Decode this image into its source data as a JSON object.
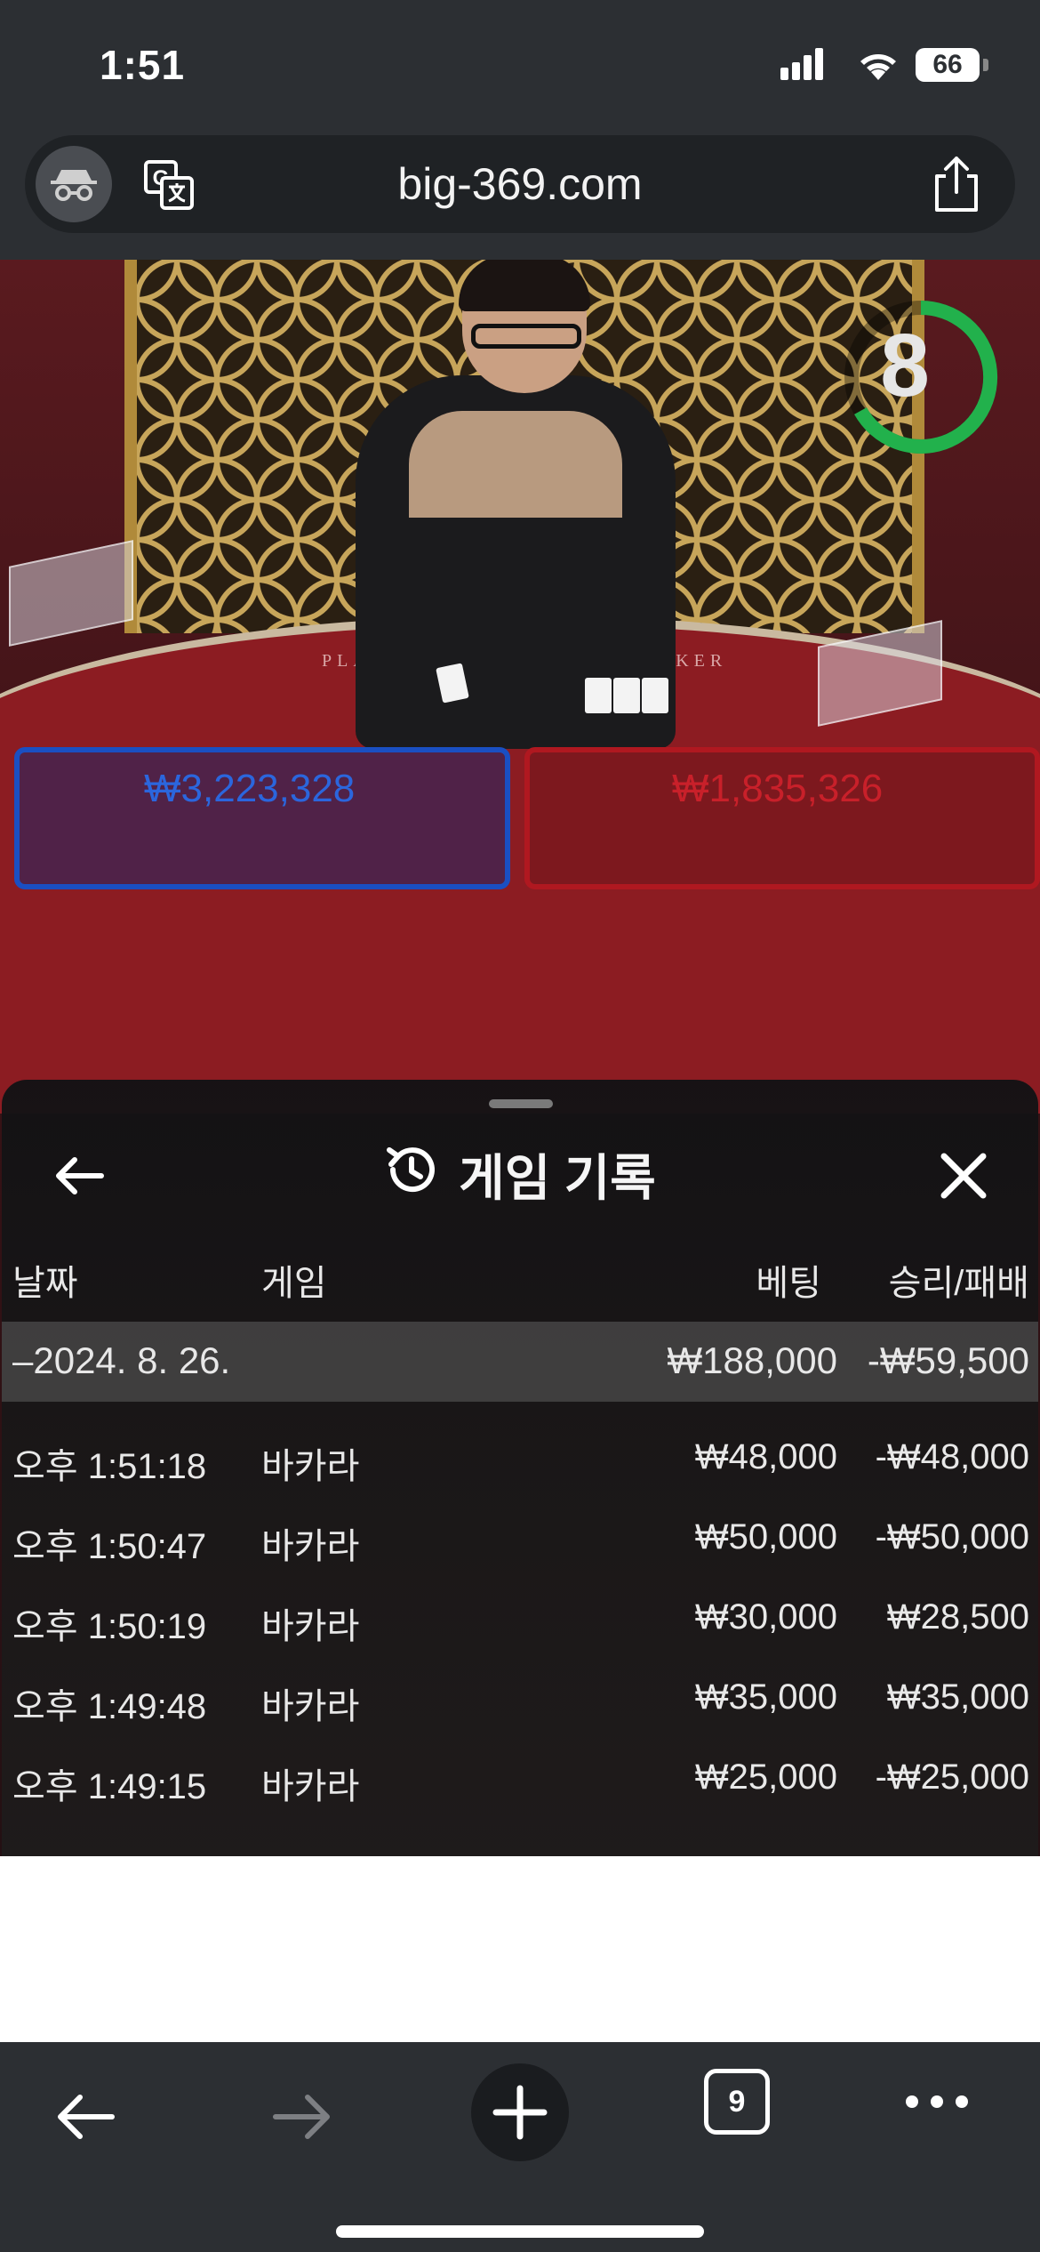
{
  "status_bar": {
    "time": "1:51",
    "battery": "66"
  },
  "browser": {
    "url": "big-369.com",
    "tab_count": "9"
  },
  "video": {
    "timer": "8",
    "table_labels": {
      "player": "PLAYER",
      "banker": "BANKER"
    },
    "player_bet": "₩3,223,328",
    "banker_bet": "₩1,835,326"
  },
  "history": {
    "title": "게임 기록",
    "headers": {
      "date": "날짜",
      "game": "게임",
      "bet": "베팅",
      "win": "승리/패배"
    },
    "summary": {
      "date": "–2024. 8. 26.",
      "bet": "₩188,000",
      "win": "-₩59,500"
    },
    "rows": [
      {
        "time": "오후 1:51:18",
        "game": "바카라",
        "bet": "₩48,000",
        "win": "-₩48,000"
      },
      {
        "time": "오후 1:50:47",
        "game": "바카라",
        "bet": "₩50,000",
        "win": "-₩50,000"
      },
      {
        "time": "오후 1:50:19",
        "game": "바카라",
        "bet": "₩30,000",
        "win": "₩28,500"
      },
      {
        "time": "오후 1:49:48",
        "game": "바카라",
        "bet": "₩35,000",
        "win": "₩35,000"
      },
      {
        "time": "오후 1:49:15",
        "game": "바카라",
        "bet": "₩25,000",
        "win": "-₩25,000"
      }
    ]
  },
  "colors": {
    "chrome": "#2c2f33",
    "timer_green": "#22b14c",
    "player_blue": "#1a4fc2",
    "banker_red": "#b01820"
  },
  "icons": [
    "incognito-icon",
    "translate-icon",
    "share-icon",
    "back-arrow-icon",
    "history-icon",
    "close-icon",
    "forward-arrow-icon",
    "plus-icon",
    "tabs-icon",
    "more-icon"
  ]
}
